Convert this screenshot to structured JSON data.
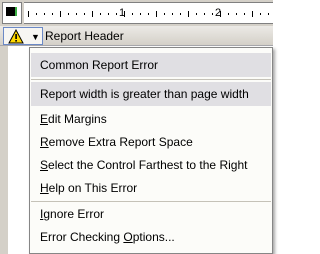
{
  "ruler": {
    "numbers": [
      "1",
      "2"
    ]
  },
  "section": {
    "title": "Report Header"
  },
  "menu": {
    "title": "Common Report Error",
    "description": "Report width is greater than page width",
    "items": [
      {
        "label": "Edit Margins",
        "mnemonic": "E"
      },
      {
        "label": "Remove Extra Report Space",
        "mnemonic": "R"
      },
      {
        "label": "Select the Control Farthest to the Right",
        "mnemonic": "S"
      },
      {
        "label": "Help on This Error",
        "mnemonic": "H"
      },
      {
        "label": "Ignore Error",
        "mnemonic": "I"
      },
      {
        "label": "Error Checking Options...",
        "mnemonic": "O"
      }
    ]
  },
  "colors": {
    "menu_background": "#fcfcf9",
    "menu_header_background": "#e0dfe3",
    "warning_yellow": "#ffd800",
    "ruler_background": "#d4d0c8"
  }
}
